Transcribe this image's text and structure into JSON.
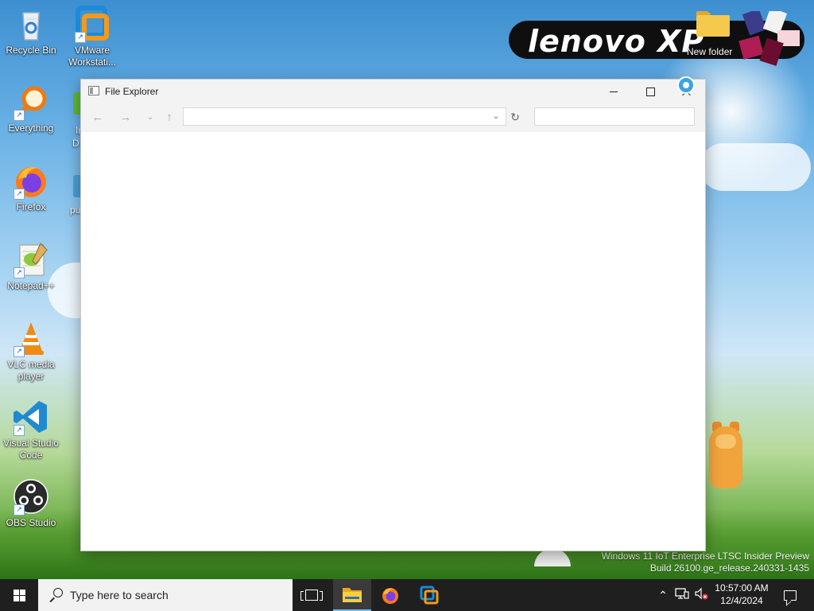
{
  "desktop": {
    "icons": [
      {
        "label": "Recycle Bin",
        "icon": "recycle-bin-icon"
      },
      {
        "label": "VMware Workstati...",
        "icon": "vmware-icon"
      },
      {
        "label": "Everything",
        "icon": "everything-search-icon"
      },
      {
        "label": "Firefox",
        "icon": "firefox-icon"
      },
      {
        "label": "Notepad++",
        "icon": "notepad-plus-plus-icon"
      },
      {
        "label": "VLC media player",
        "icon": "vlc-icon"
      },
      {
        "label": "Visual Studio Code",
        "icon": "vscode-icon"
      },
      {
        "label": "OBS Studio",
        "icon": "obs-icon"
      },
      {
        "label": "New folder",
        "icon": "folder-icon"
      }
    ],
    "partial_labels": [
      "In",
      "D",
      "pu"
    ],
    "banner_text": "lenovo XP",
    "watermark": {
      "line1": "Windows 11 IoT Enterprise LTSC Insider Preview",
      "line2": "Build 26100.ge_release.240331-1435"
    }
  },
  "window": {
    "title": "File Explorer",
    "address_value": "",
    "search_value": ""
  },
  "taskbar": {
    "search_placeholder": "Type here to search",
    "pinned": [
      "task-view-icon",
      "file-explorer-icon",
      "firefox-icon",
      "vmware-icon"
    ],
    "time": "10:57:00 AM",
    "date": "12/4/2024"
  },
  "colors": {
    "taskbar": "#1f1f1f",
    "accent": "#76b9ed"
  }
}
